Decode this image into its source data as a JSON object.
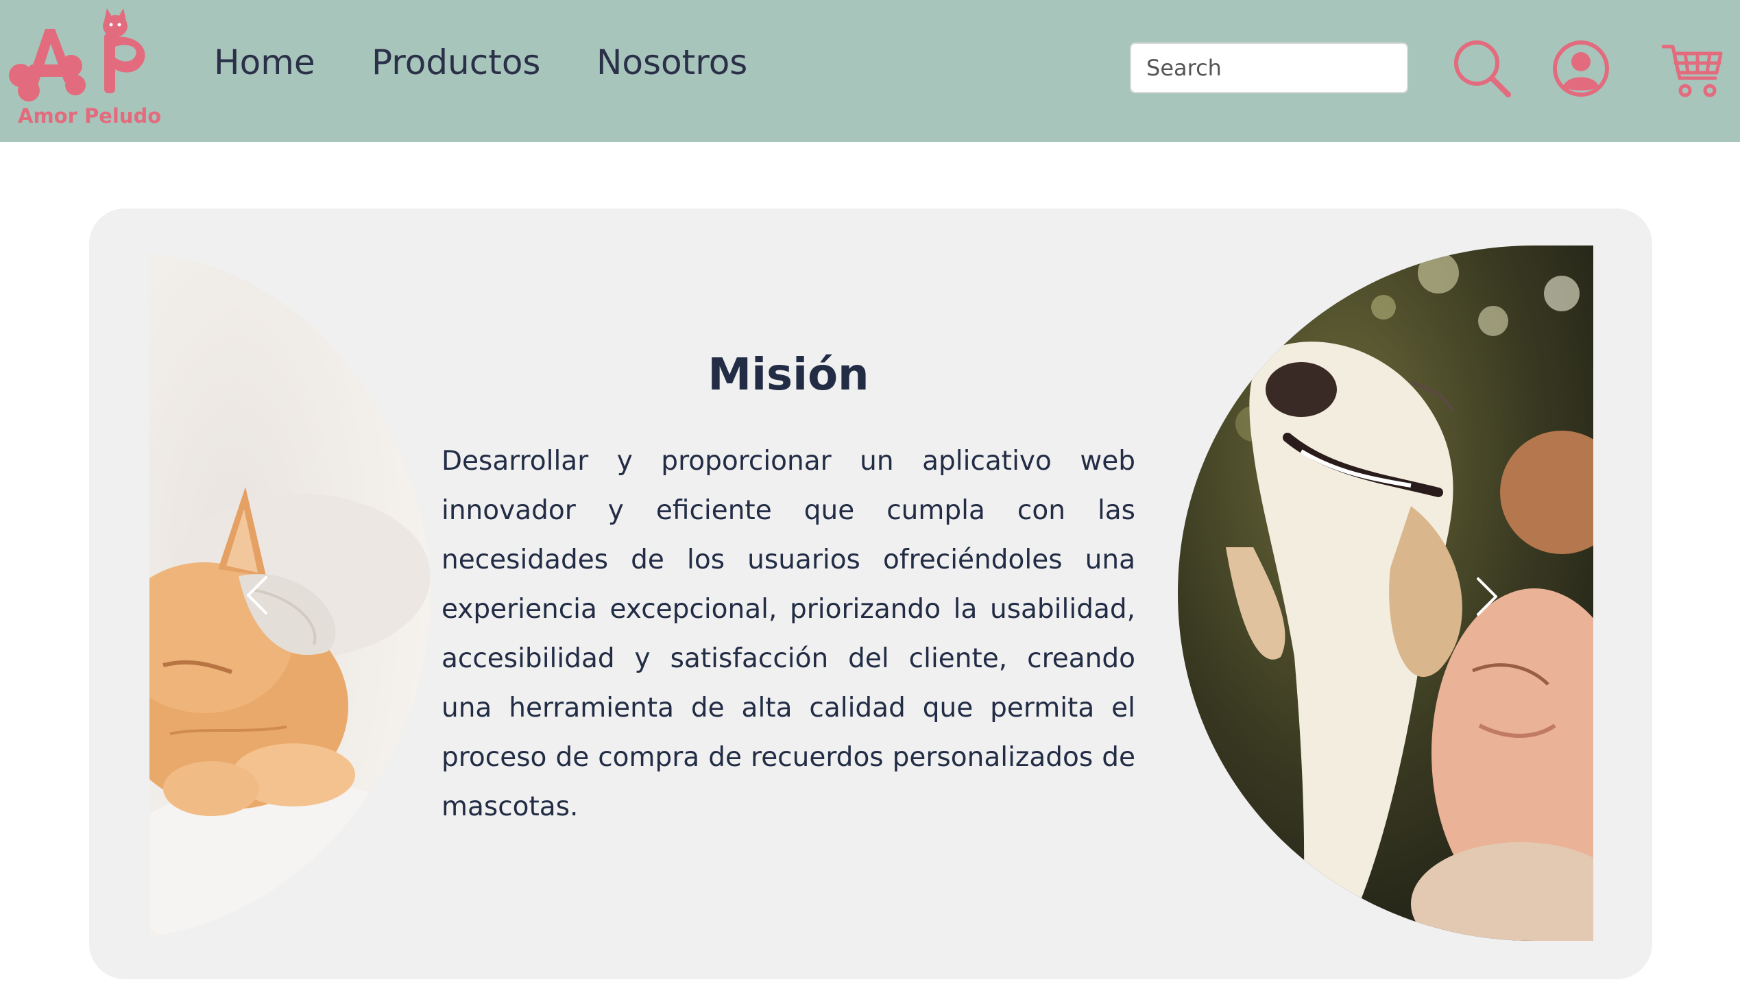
{
  "brand": {
    "name": "Amor Peludo",
    "accent_color": "#e36b7e",
    "header_color": "#a8c5bb"
  },
  "nav": {
    "items": [
      {
        "label": "Home"
      },
      {
        "label": "Productos"
      },
      {
        "label": "Nosotros"
      }
    ]
  },
  "search": {
    "placeholder": "Search"
  },
  "icons": {
    "search": "search-icon",
    "user": "user-icon",
    "cart": "cart-icon"
  },
  "carousel": {
    "title": "Misión",
    "text": "Desarrollar y proporcionar un aplicativo web innovador y eficiente que cumpla con las necesidades de los usuarios ofreciéndoles una experiencia excepcional, priorizando la usabilidad, accesibilidad y satisfacción del cliente, creando una herramienta de alta calidad que permita el proceso de compra de recuerdos personalizados de mascotas.",
    "card_color": "#f0f0f0"
  }
}
